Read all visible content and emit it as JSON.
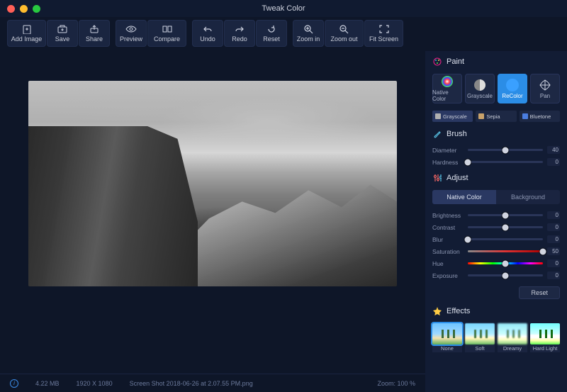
{
  "title": "Tweak Color",
  "toolbar": [
    {
      "name": "add-image",
      "label": "Add Image"
    },
    {
      "name": "save",
      "label": "Save"
    },
    {
      "name": "share",
      "label": "Share"
    },
    {
      "name": "preview",
      "label": "Preview"
    },
    {
      "name": "compare",
      "label": "Compare"
    },
    {
      "name": "undo",
      "label": "Undo"
    },
    {
      "name": "redo",
      "label": "Redo"
    },
    {
      "name": "reset",
      "label": "Reset"
    },
    {
      "name": "zoom-in",
      "label": "Zoom in"
    },
    {
      "name": "zoom-out",
      "label": "Zoom out"
    },
    {
      "name": "fit-screen",
      "label": "Fit Screen"
    }
  ],
  "status": {
    "filesize": "4.22 MB",
    "dimensions": "1920 X 1080",
    "filename": "Screen Shot 2018-06-26 at 2.07.55 PM.png",
    "zoom": "Zoom: 100 %"
  },
  "paint": {
    "heading": "Paint",
    "modes": [
      {
        "name": "native",
        "label": "Native Color"
      },
      {
        "name": "grayscale",
        "label": "Grayscale"
      },
      {
        "name": "recolor",
        "label": "ReColor"
      },
      {
        "name": "pan",
        "label": "Pan"
      }
    ],
    "active_mode": "recolor",
    "presets": [
      {
        "name": "grayscale",
        "label": "Grayscale",
        "color": "#b0b0b0",
        "selected": true
      },
      {
        "name": "sepia",
        "label": "Sepia",
        "color": "#c9a26a",
        "selected": false
      },
      {
        "name": "bluetone",
        "label": "Bluetone",
        "color": "#4a7de0",
        "selected": false
      }
    ]
  },
  "brush": {
    "heading": "Brush",
    "diameter": {
      "label": "Diameter",
      "value": 40,
      "pct": 50
    },
    "hardness": {
      "label": "Hardness",
      "value": 0,
      "pct": 0
    }
  },
  "adjust": {
    "heading": "Adjust",
    "tabs": [
      {
        "name": "native",
        "label": "Native Color",
        "active": true
      },
      {
        "name": "background",
        "label": "Background",
        "active": false
      }
    ],
    "sliders": [
      {
        "key": "brightness",
        "label": "Brightness",
        "value": 0,
        "pct": 50,
        "cls": ""
      },
      {
        "key": "contrast",
        "label": "Contrast",
        "value": 0,
        "pct": 50,
        "cls": ""
      },
      {
        "key": "blur",
        "label": "Blur",
        "value": 0,
        "pct": 0,
        "cls": ""
      },
      {
        "key": "saturation",
        "label": "Saturation",
        "value": 50,
        "pct": 100,
        "cls": "sat"
      },
      {
        "key": "hue",
        "label": "Hue",
        "value": 0,
        "pct": 50,
        "cls": "hue"
      },
      {
        "key": "exposure",
        "label": "Exposure",
        "value": 0,
        "pct": 50,
        "cls": ""
      }
    ],
    "reset_label": "Reset"
  },
  "effects": {
    "heading": "Effects",
    "items": [
      {
        "name": "none",
        "label": "None",
        "selected": true,
        "cls": ""
      },
      {
        "name": "soft",
        "label": "Soft",
        "selected": false,
        "cls": "soft"
      },
      {
        "name": "dreamy",
        "label": "Dreamy",
        "selected": false,
        "cls": "dreamy"
      },
      {
        "name": "hard-light",
        "label": "Hard Light",
        "selected": false,
        "cls": "hard"
      }
    ]
  }
}
